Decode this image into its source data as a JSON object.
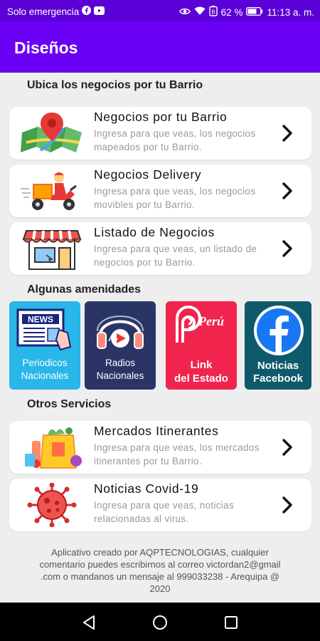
{
  "status_bar": {
    "carrier": "Solo emergencia",
    "battery": "62 %",
    "time": "11:13 a. m."
  },
  "app_bar": {
    "title": "Diseños"
  },
  "sections": {
    "barrio_title": "Ubica los negocios por tu Barrio",
    "amenidades_title": "Algunas amenidades",
    "otros_title": "Otros Servicios"
  },
  "cards": [
    {
      "title": "Negocios por tu Barrio",
      "desc": "Ingresa para que veas, los negocios mapeados por tu Barrio.",
      "icon": "map-pin-icon"
    },
    {
      "title": "Negocios Delivery",
      "desc": "Ingresa para que veas, los negocios movibles por tu Barrio.",
      "icon": "delivery-scooter-icon"
    },
    {
      "title": "Listado de Negocios",
      "desc": "Ingresa para que veas, un listado de negocios por tu Barrio.",
      "icon": "storefront-icon"
    },
    {
      "title": "Mercados Itinerantes",
      "desc": "Ingresa para que veas, los mercados itinerantes por tu Barrio.",
      "icon": "grocery-bag-icon"
    },
    {
      "title": "Noticias Covid-19",
      "desc": "Ingresa para que veas, noticias relacionadas al virus.",
      "icon": "virus-icon"
    }
  ],
  "tiles": [
    {
      "label_line1": "Periodicos",
      "label_line2": "Nacionales",
      "icon_text": "NEWS",
      "color": "#29b6e8"
    },
    {
      "label_line1": "Radios",
      "label_line2": "Nacionales",
      "color": "#2a3566"
    },
    {
      "label_line1": "Link",
      "label_line2": "del Estado",
      "icon_text": "Perú",
      "color": "#f0244d"
    },
    {
      "label_line1": "Noticias",
      "label_line2": "Facebook",
      "color": "#0f5a6a"
    }
  ],
  "footer": {
    "line1": "Aplicativo creado por AQPTECNOLOGIAS, cualquier",
    "line2": "comentario puedes escribirnos al correo victordan2@gmail",
    "line3": ".com o mandanos un mensaje al 999033238 - Arequipa @",
    "line4": "2020"
  },
  "colors": {
    "status_bar": "#5b00d6",
    "app_bar": "#6a00f4",
    "background": "#eeeeee"
  }
}
